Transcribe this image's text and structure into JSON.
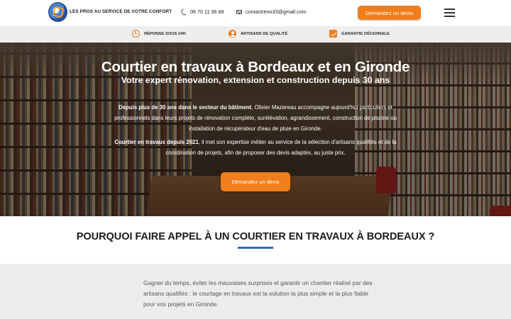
{
  "header": {
    "tagline": "LES PROS AU SERVICE DE VOTRE CONFORT",
    "phone": "06 70 11 36 68",
    "email": "contactreno33@gmail.com",
    "cta_label": "Demandez un devis"
  },
  "features": [
    {
      "label": "RÉPONSE SOUS 24H",
      "icon": "clock-icon"
    },
    {
      "label": "ARTISANS DE QUALITÉ",
      "icon": "user-icon"
    },
    {
      "label": "GARANTIE DÉCENNALE",
      "icon": "check-icon"
    }
  ],
  "hero": {
    "title": "Courtier en travaux à Bordeaux et en Gironde",
    "subtitle": "Votre expert rénovation, extension et construction depuis 30 ans",
    "p1_bold": "Depuis plus de 30 ans dans le secteur du bâtiment",
    "p1_rest": ", Olivier Mazereau accompagne aujourd'hui particuliers et professionnels dans leurs projets de rénovation complète, surélévation, agrandissement, construction de piscine ou installation de récupérateur d'eau de pluie en Gironde.",
    "p2_bold": "Courtier en travaux depuis 2021",
    "p2_rest": ", il met son expertise métier au service de la sélection d'artisans qualifiés et de la coordination de projets, afin de proposer des devis adaptés, au juste prix.",
    "cta_label": "Demandez un devis"
  },
  "why": {
    "title": "POURQUOI FAIRE APPEL À UN COURTIER EN TRAVAUX À BORDEAUX ?",
    "accent": "#3569b8"
  },
  "intro": {
    "text": "Gagner du temps, éviter les mauvaises surprises et garantir un chantier réalisé par des artisans qualifiés : le courtage en travaux est la solution la plus simple et la plus fiable pour vos projets en Gironde."
  },
  "colors": {
    "brand_orange": "#f07e1c",
    "feature_bar": "#eeeeef"
  }
}
